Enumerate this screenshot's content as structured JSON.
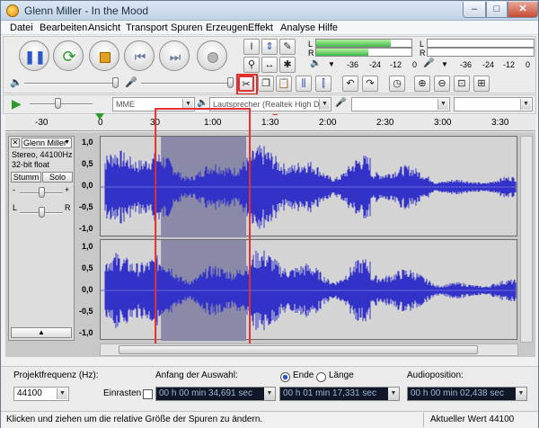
{
  "window": {
    "title": "Glenn Miller - In the Mood"
  },
  "menu": [
    "Datei",
    "Bearbeiten",
    "Ansicht",
    "Transport",
    "Spuren",
    "Erzeugen",
    "Effekt",
    "Analyse",
    "Hilfe"
  ],
  "meters": {
    "left_label": "L",
    "right_label": "R",
    "left_level": 0.78,
    "right_level": 0.55,
    "scale": [
      "-36",
      "-24",
      "-12",
      "0"
    ],
    "rec_scale": [
      "-36",
      "-24",
      "-12",
      "0"
    ]
  },
  "device": {
    "host": "MME",
    "output": "Lautsprecher (Realtek High Defi"
  },
  "ruler": [
    "-30",
    "0",
    "30",
    "1:00",
    "1:30",
    "2:00",
    "2:30",
    "3:00",
    "3:30"
  ],
  "track": {
    "name": "Glenn Miller",
    "info_line1": "Stereo, 44100Hz",
    "info_line2": "32-bit float",
    "mute_label": "Stumm",
    "solo_label": "Solo",
    "gain_minus": "-",
    "gain_plus": "+",
    "pan_left": "L",
    "pan_right": "R",
    "amplitude_labels": [
      "1,0",
      "0,5",
      "0,0",
      "-0,5",
      "-1,0"
    ],
    "selection_start": 0.145,
    "selection_end": 0.35
  },
  "bottom": {
    "rate_label": "Projektfrequenz (Hz):",
    "rate_value": "44100",
    "snap_label": "Einrasten",
    "selection_start_label": "Anfang der Auswahl:",
    "end_label": "Ende",
    "length_label": "Länge",
    "audio_position_label": "Audioposition:",
    "start_time": "00 h 00 min 34,691 sec",
    "end_time": "00 h 01 min 17,331 sec",
    "position_time": "00 h 00 min 02,438 sec"
  },
  "status": {
    "hint": "Klicken und ziehen um die relative Größe der Spuren zu ändern.",
    "value": "Aktueller Wert 44100"
  },
  "colors": {
    "waveform": "#3232c8",
    "selection": "#8a8aa8",
    "highlight": "#e03030",
    "meter_green": "#3cb84a"
  }
}
